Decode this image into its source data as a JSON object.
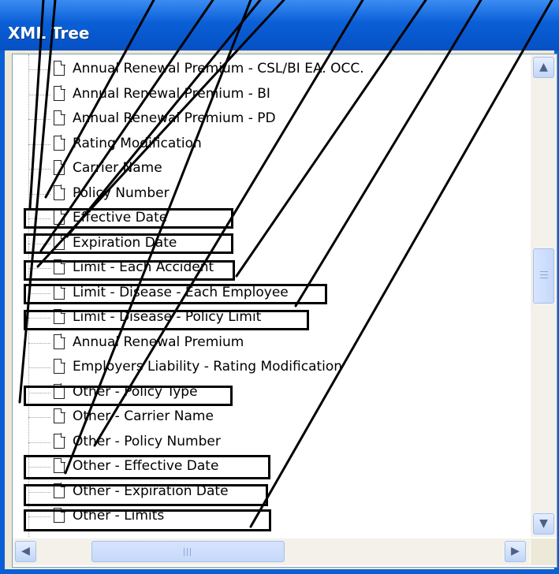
{
  "window": {
    "title": "XML Tree"
  },
  "tree": {
    "items": [
      {
        "label": "Annual Renewal Premium - CSL/BI EA. OCC."
      },
      {
        "label": "Annual Renewal Premium - BI"
      },
      {
        "label": "Annual Renewal Premium - PD"
      },
      {
        "label": "Rating Modification"
      },
      {
        "label": "Carrier Name"
      },
      {
        "label": "Policy Number"
      },
      {
        "label": "Effective Date"
      },
      {
        "label": "Expiration Date"
      },
      {
        "label": "Limit - Each Accident"
      },
      {
        "label": "Limit - Disease - Each Employee"
      },
      {
        "label": "Limit - Disease - Policy Limit"
      },
      {
        "label": "Annual Renewal Premium"
      },
      {
        "label": "Employers Liability - Rating Modification"
      },
      {
        "label": "Other - Policy Type"
      },
      {
        "label": "Other - Carrier Name"
      },
      {
        "label": "Other - Policy Number"
      },
      {
        "label": "Other - Effective Date"
      },
      {
        "label": "Other - Expiration Date"
      },
      {
        "label": "Other - Limits"
      }
    ]
  },
  "highlighted_items": [
    "Effective Date",
    "Expiration Date",
    "Limit - Each Accident",
    "Limit - Disease - Each Employee",
    "Limit - Disease - Policy Limit",
    "Other - Policy Type",
    "Other - Effective Date",
    "Other - Expiration Date",
    "Other - Limits"
  ],
  "icons": {
    "item": "document-icon",
    "scroll_up": "up-arrow-icon",
    "scroll_down": "down-arrow-icon",
    "scroll_left": "left-arrow-icon",
    "scroll_right": "right-arrow-icon"
  },
  "colors": {
    "titlebar": "#0a5fd6",
    "highlight_border": "#000000",
    "scrollbar": "#c6d8f9"
  }
}
